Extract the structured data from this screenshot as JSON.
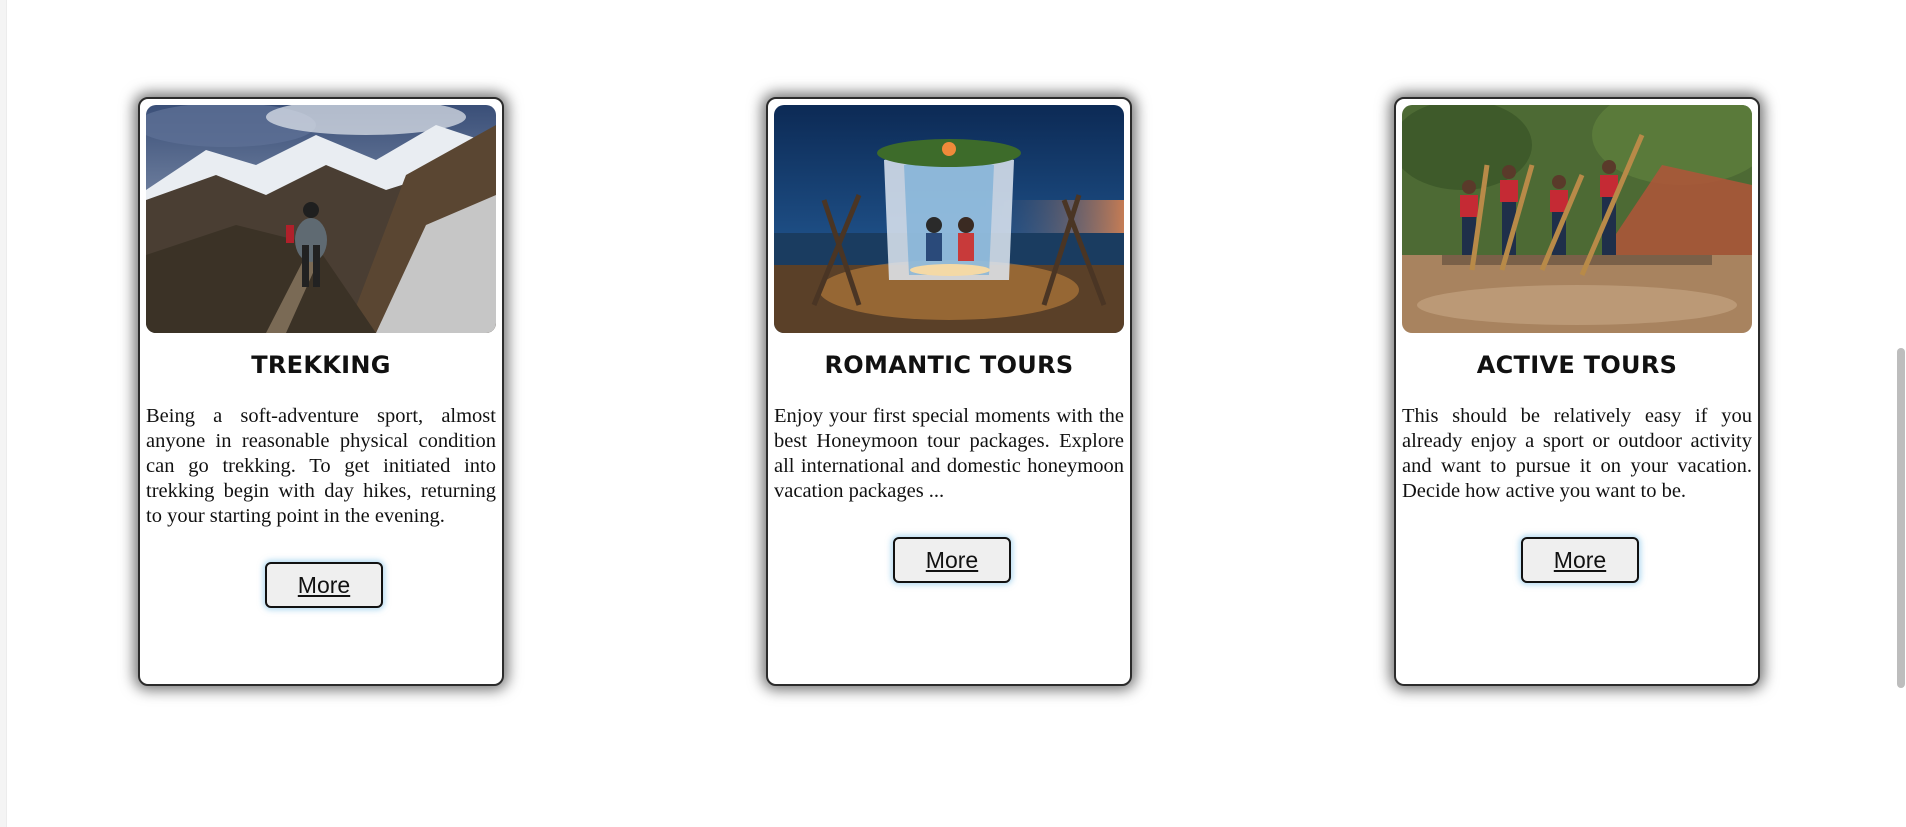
{
  "cards": [
    {
      "title": "TREKKING",
      "text": "Being a soft-adventure sport, almost anyone in reasonable physical condition can go trekking. To get initiated into trekking begin with day hikes, returning to your starting point in the evening.",
      "button_label": "More",
      "image": "mountain-trekker-photo"
    },
    {
      "title": "ROMANTIC TOURS",
      "text": "Enjoy your first special moments with the best Honeymoon tour packages. Explore all international and domestic honeymoon vacation packages ...",
      "button_label": "More",
      "image": "beach-dinner-canopy-photo"
    },
    {
      "title": "ACTIVE TOURS",
      "text": "This should be relatively easy if you already enjoy a sport or outdoor activity and want to pursue it on your vacation. Decide how active you want to be.",
      "button_label": "More",
      "image": "bamboo-rafting-photo"
    }
  ],
  "colors": {
    "background": "#ffffff",
    "card_border": "#2b2b2b",
    "button_fill": "#efefef",
    "button_glow": "#78bee6",
    "text": "#111111"
  }
}
